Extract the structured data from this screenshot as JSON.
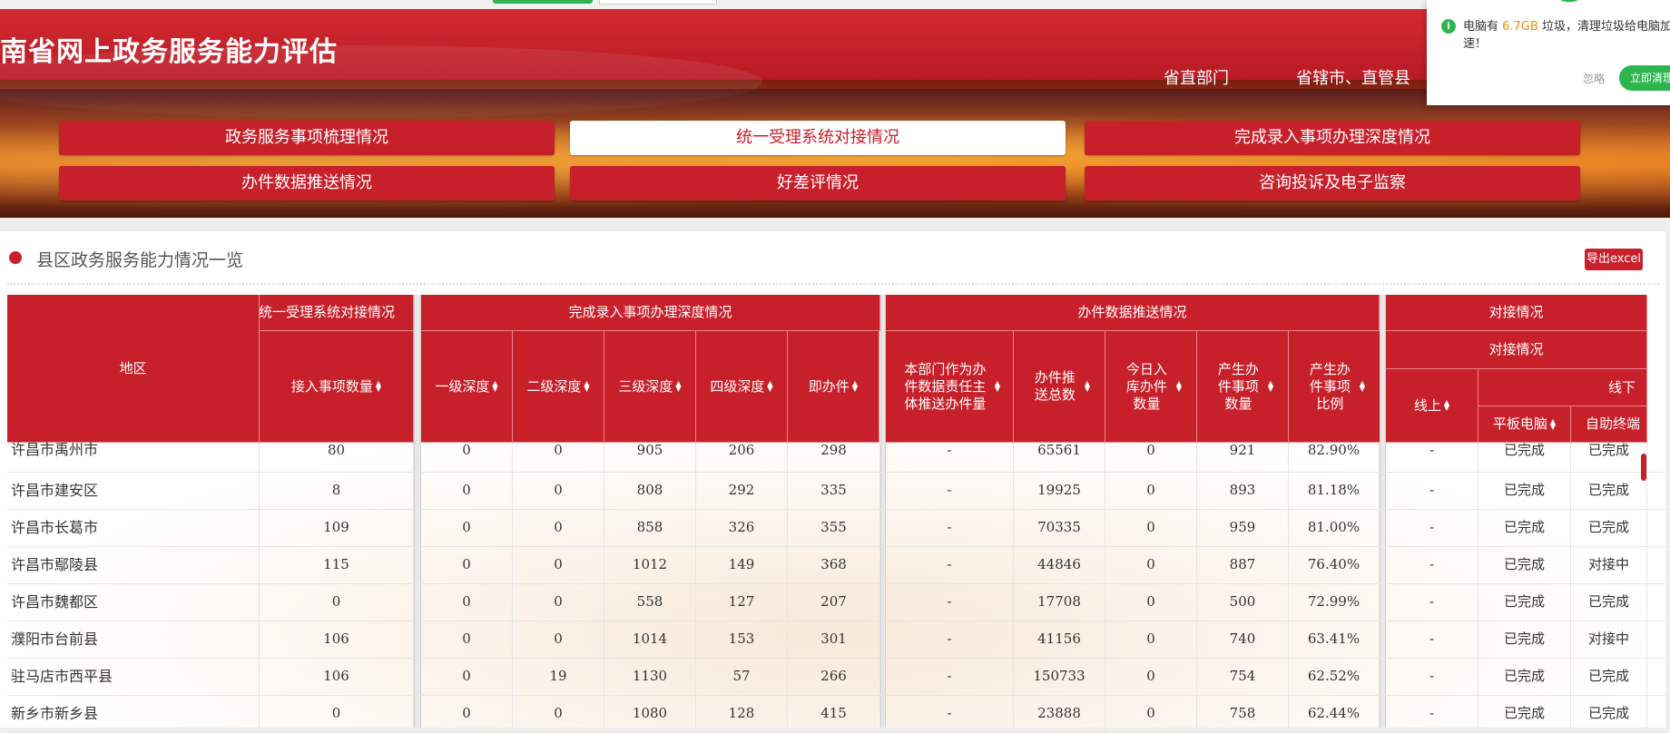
{
  "site": {
    "title": "南省网上政务服务能力评估",
    "top_links": [
      "省直部门",
      "省辖市、直管县"
    ]
  },
  "nav": {
    "row1": [
      "政务服务事项梳理情况",
      "统一受理系统对接情况",
      "完成录入事项办理深度情况"
    ],
    "row2": [
      "办件数据推送情况",
      "好差评情况",
      "咨询投诉及电子监察"
    ],
    "active": "统一受理系统对接情况"
  },
  "popup": {
    "msg_prefix": "电脑有 ",
    "size": "6.7GB",
    "msg_suffix": " 垃圾，清理垃圾给电脑加速！",
    "ignore": "忽略",
    "clean_button": "立即清理"
  },
  "section": {
    "title": "县区政务服务能力情况一览",
    "export_label": "导出excel"
  },
  "table": {
    "group_headers": {
      "region": "地区",
      "unified": "统一受理系统对接情况",
      "depth": "完成录入事项办理深度情况",
      "push": "办件数据推送情况",
      "dock": "对接情况",
      "offline": "线下"
    },
    "columns": {
      "access_count": "接入事项数量",
      "lv1": "一级深度",
      "lv2": "二级深度",
      "lv3": "三级深度",
      "lv4": "四级深度",
      "instant": "即办件",
      "dept_push": "本部门作为办件数据责任主体推送办件量",
      "push_total": "办件推送总数",
      "today_in": "今日入库办件数量",
      "gen_items": "产生办件事项数量",
      "gen_ratio": "产生办件事项比例",
      "online": "线上",
      "tablet": "平板电脑",
      "kiosk": "自助终端"
    },
    "rows": [
      {
        "region": "许昌市禹州市",
        "access": "80",
        "l1": "0",
        "l2": "0",
        "l3": "905",
        "l4": "206",
        "inst": "298",
        "dept": "-",
        "total": "65561",
        "today": "0",
        "items": "921",
        "ratio": "82.90%",
        "online": "-",
        "tablet": "已完成",
        "kiosk": "已完成"
      },
      {
        "region": "许昌市建安区",
        "access": "8",
        "l1": "0",
        "l2": "0",
        "l3": "808",
        "l4": "292",
        "inst": "335",
        "dept": "-",
        "total": "19925",
        "today": "0",
        "items": "893",
        "ratio": "81.18%",
        "online": "-",
        "tablet": "已完成",
        "kiosk": "已完成"
      },
      {
        "region": "许昌市长葛市",
        "access": "109",
        "l1": "0",
        "l2": "0",
        "l3": "858",
        "l4": "326",
        "inst": "355",
        "dept": "-",
        "total": "70335",
        "today": "0",
        "items": "959",
        "ratio": "81.00%",
        "online": "-",
        "tablet": "已完成",
        "kiosk": "已完成"
      },
      {
        "region": "许昌市鄢陵县",
        "access": "115",
        "l1": "0",
        "l2": "0",
        "l3": "1012",
        "l4": "149",
        "inst": "368",
        "dept": "-",
        "total": "44846",
        "today": "0",
        "items": "887",
        "ratio": "76.40%",
        "online": "-",
        "tablet": "已完成",
        "kiosk": "对接中"
      },
      {
        "region": "许昌市魏都区",
        "access": "0",
        "l1": "0",
        "l2": "0",
        "l3": "558",
        "l4": "127",
        "inst": "207",
        "dept": "-",
        "total": "17708",
        "today": "0",
        "items": "500",
        "ratio": "72.99%",
        "online": "-",
        "tablet": "已完成",
        "kiosk": "已完成"
      },
      {
        "region": "濮阳市台前县",
        "access": "106",
        "l1": "0",
        "l2": "0",
        "l3": "1014",
        "l4": "153",
        "inst": "301",
        "dept": "-",
        "total": "41156",
        "today": "0",
        "items": "740",
        "ratio": "63.41%",
        "online": "-",
        "tablet": "已完成",
        "kiosk": "对接中"
      },
      {
        "region": "驻马店市西平县",
        "access": "106",
        "l1": "0",
        "l2": "19",
        "l3": "1130",
        "l4": "57",
        "inst": "266",
        "dept": "-",
        "total": "150733",
        "today": "0",
        "items": "754",
        "ratio": "62.52%",
        "online": "-",
        "tablet": "已完成",
        "kiosk": "已完成"
      },
      {
        "region": "新乡市新乡县",
        "access": "0",
        "l1": "0",
        "l2": "0",
        "l3": "1080",
        "l4": "128",
        "inst": "415",
        "dept": "-",
        "total": "23888",
        "today": "0",
        "items": "758",
        "ratio": "62.44%",
        "online": "-",
        "tablet": "已完成",
        "kiosk": "已完成"
      }
    ]
  }
}
